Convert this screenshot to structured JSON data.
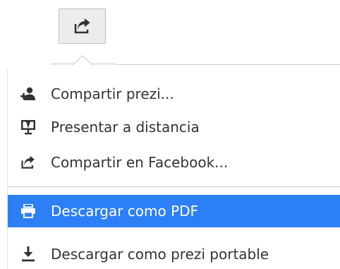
{
  "toolbar": {
    "share_button_icon": "share-arrow-icon"
  },
  "menu": {
    "items": [
      {
        "label": "Compartir prezi...",
        "icon": "add-user-icon"
      },
      {
        "label": "Presentar a distancia",
        "icon": "presentation-screen-icon"
      },
      {
        "label": "Compartir en Facebook...",
        "icon": "share-arrow-icon"
      },
      {
        "label": "Descargar como PDF",
        "icon": "printer-icon",
        "highlighted": true
      },
      {
        "label": "Descargar como prezi portable",
        "icon": "download-icon"
      }
    ]
  },
  "colors": {
    "highlight": "#2d7ff5",
    "text": "#333333",
    "icon": "#333333"
  }
}
